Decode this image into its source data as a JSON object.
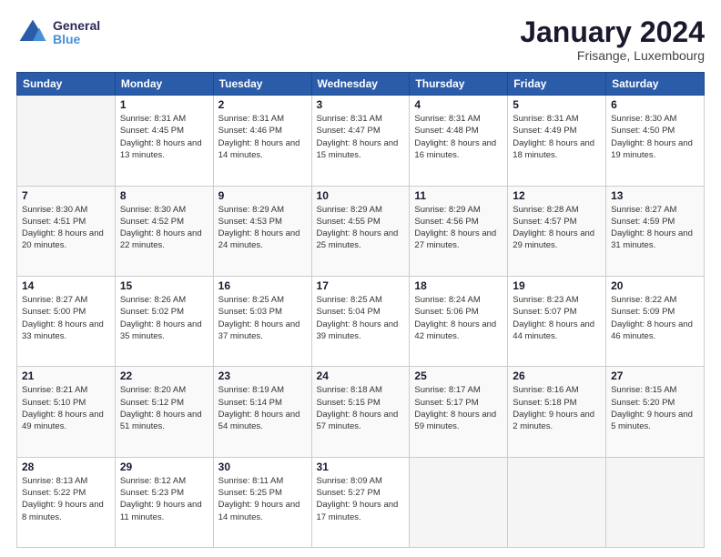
{
  "header": {
    "logo_line1": "General",
    "logo_line2": "Blue",
    "main_title": "January 2024",
    "subtitle": "Frisange, Luxembourg"
  },
  "calendar": {
    "days_of_week": [
      "Sunday",
      "Monday",
      "Tuesday",
      "Wednesday",
      "Thursday",
      "Friday",
      "Saturday"
    ],
    "weeks": [
      [
        {
          "num": "",
          "info": ""
        },
        {
          "num": "1",
          "info": "Sunrise: 8:31 AM\nSunset: 4:45 PM\nDaylight: 8 hours\nand 13 minutes."
        },
        {
          "num": "2",
          "info": "Sunrise: 8:31 AM\nSunset: 4:46 PM\nDaylight: 8 hours\nand 14 minutes."
        },
        {
          "num": "3",
          "info": "Sunrise: 8:31 AM\nSunset: 4:47 PM\nDaylight: 8 hours\nand 15 minutes."
        },
        {
          "num": "4",
          "info": "Sunrise: 8:31 AM\nSunset: 4:48 PM\nDaylight: 8 hours\nand 16 minutes."
        },
        {
          "num": "5",
          "info": "Sunrise: 8:31 AM\nSunset: 4:49 PM\nDaylight: 8 hours\nand 18 minutes."
        },
        {
          "num": "6",
          "info": "Sunrise: 8:30 AM\nSunset: 4:50 PM\nDaylight: 8 hours\nand 19 minutes."
        }
      ],
      [
        {
          "num": "7",
          "info": "Sunrise: 8:30 AM\nSunset: 4:51 PM\nDaylight: 8 hours\nand 20 minutes."
        },
        {
          "num": "8",
          "info": "Sunrise: 8:30 AM\nSunset: 4:52 PM\nDaylight: 8 hours\nand 22 minutes."
        },
        {
          "num": "9",
          "info": "Sunrise: 8:29 AM\nSunset: 4:53 PM\nDaylight: 8 hours\nand 24 minutes."
        },
        {
          "num": "10",
          "info": "Sunrise: 8:29 AM\nSunset: 4:55 PM\nDaylight: 8 hours\nand 25 minutes."
        },
        {
          "num": "11",
          "info": "Sunrise: 8:29 AM\nSunset: 4:56 PM\nDaylight: 8 hours\nand 27 minutes."
        },
        {
          "num": "12",
          "info": "Sunrise: 8:28 AM\nSunset: 4:57 PM\nDaylight: 8 hours\nand 29 minutes."
        },
        {
          "num": "13",
          "info": "Sunrise: 8:27 AM\nSunset: 4:59 PM\nDaylight: 8 hours\nand 31 minutes."
        }
      ],
      [
        {
          "num": "14",
          "info": "Sunrise: 8:27 AM\nSunset: 5:00 PM\nDaylight: 8 hours\nand 33 minutes."
        },
        {
          "num": "15",
          "info": "Sunrise: 8:26 AM\nSunset: 5:02 PM\nDaylight: 8 hours\nand 35 minutes."
        },
        {
          "num": "16",
          "info": "Sunrise: 8:25 AM\nSunset: 5:03 PM\nDaylight: 8 hours\nand 37 minutes."
        },
        {
          "num": "17",
          "info": "Sunrise: 8:25 AM\nSunset: 5:04 PM\nDaylight: 8 hours\nand 39 minutes."
        },
        {
          "num": "18",
          "info": "Sunrise: 8:24 AM\nSunset: 5:06 PM\nDaylight: 8 hours\nand 42 minutes."
        },
        {
          "num": "19",
          "info": "Sunrise: 8:23 AM\nSunset: 5:07 PM\nDaylight: 8 hours\nand 44 minutes."
        },
        {
          "num": "20",
          "info": "Sunrise: 8:22 AM\nSunset: 5:09 PM\nDaylight: 8 hours\nand 46 minutes."
        }
      ],
      [
        {
          "num": "21",
          "info": "Sunrise: 8:21 AM\nSunset: 5:10 PM\nDaylight: 8 hours\nand 49 minutes."
        },
        {
          "num": "22",
          "info": "Sunrise: 8:20 AM\nSunset: 5:12 PM\nDaylight: 8 hours\nand 51 minutes."
        },
        {
          "num": "23",
          "info": "Sunrise: 8:19 AM\nSunset: 5:14 PM\nDaylight: 8 hours\nand 54 minutes."
        },
        {
          "num": "24",
          "info": "Sunrise: 8:18 AM\nSunset: 5:15 PM\nDaylight: 8 hours\nand 57 minutes."
        },
        {
          "num": "25",
          "info": "Sunrise: 8:17 AM\nSunset: 5:17 PM\nDaylight: 8 hours\nand 59 minutes."
        },
        {
          "num": "26",
          "info": "Sunrise: 8:16 AM\nSunset: 5:18 PM\nDaylight: 9 hours\nand 2 minutes."
        },
        {
          "num": "27",
          "info": "Sunrise: 8:15 AM\nSunset: 5:20 PM\nDaylight: 9 hours\nand 5 minutes."
        }
      ],
      [
        {
          "num": "28",
          "info": "Sunrise: 8:13 AM\nSunset: 5:22 PM\nDaylight: 9 hours\nand 8 minutes."
        },
        {
          "num": "29",
          "info": "Sunrise: 8:12 AM\nSunset: 5:23 PM\nDaylight: 9 hours\nand 11 minutes."
        },
        {
          "num": "30",
          "info": "Sunrise: 8:11 AM\nSunset: 5:25 PM\nDaylight: 9 hours\nand 14 minutes."
        },
        {
          "num": "31",
          "info": "Sunrise: 8:09 AM\nSunset: 5:27 PM\nDaylight: 9 hours\nand 17 minutes."
        },
        {
          "num": "",
          "info": ""
        },
        {
          "num": "",
          "info": ""
        },
        {
          "num": "",
          "info": ""
        }
      ]
    ]
  }
}
